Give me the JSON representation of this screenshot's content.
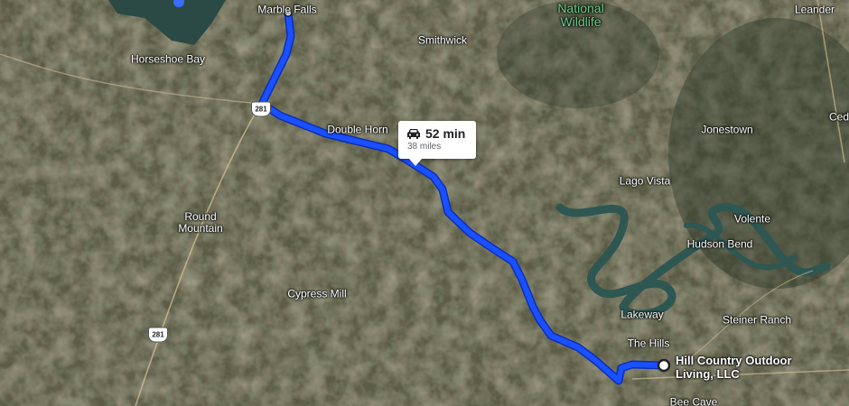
{
  "map": {
    "places": {
      "marble_falls": "Marble Falls",
      "national_wildlife": "National\nWildlife",
      "leander": "Leander",
      "smithwick": "Smithwick",
      "horseshoe_bay": "Horseshoe Bay",
      "double_horn": "Double Horn",
      "jonestown": "Jonestown",
      "ced": "Ced",
      "lago_vista": "Lago Vista",
      "round_mountain": "Round\nMountain",
      "volente": "Volente",
      "hudson_bend": "Hudson Bend",
      "cypress_mill": "Cypress Mill",
      "lakeway": "Lakeway",
      "steiner_ranch": "Steiner Ranch",
      "the_hills": "The Hills",
      "bee_cave": "Bee Cave"
    },
    "highways": {
      "us281_north": "281",
      "us281_south": "281"
    },
    "destination": {
      "name": "Hill Country Outdoor\nLiving, LLC"
    },
    "route_callout": {
      "icon": "car-icon",
      "duration": "52 min",
      "distance": "38 miles"
    },
    "colors": {
      "route": "#1a50ff",
      "route_outline": "#0b2fb5",
      "river": "#2f5f5a",
      "terrain": "#5a5a44"
    }
  }
}
